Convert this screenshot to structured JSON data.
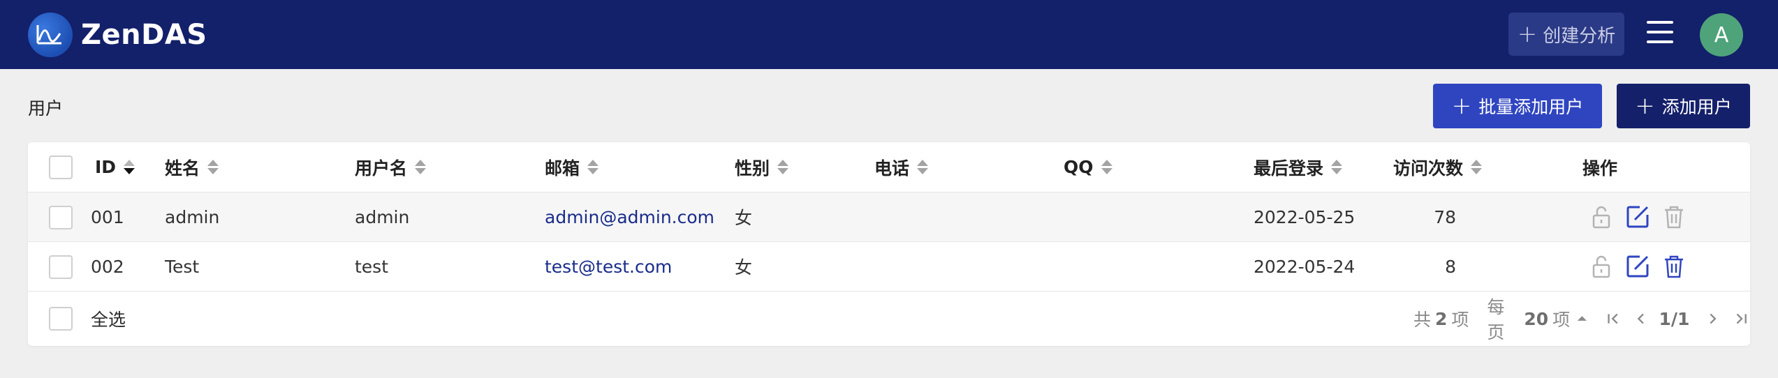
{
  "app": {
    "brand": "ZenDAS",
    "create_label": "创建分析",
    "avatar_letter": "A",
    "colors": {
      "header": "#13206a",
      "primary": "#2f45c0",
      "dark": "#14206a",
      "avatar": "#4fa37a",
      "link": "#1a2c8a"
    }
  },
  "page": {
    "title": "用户",
    "batch_add_label": "批量添加用户",
    "add_label": "添加用户"
  },
  "table": {
    "columns": [
      "ID",
      "姓名",
      "用户名",
      "邮箱",
      "性别",
      "电话",
      "QQ",
      "最后登录",
      "访问次数",
      "操作"
    ],
    "rows": [
      {
        "id": "001",
        "name": "admin",
        "username": "admin",
        "email": "admin@admin.com",
        "gender": "女",
        "phone": "",
        "qq": "",
        "last_login": "2022-05-25",
        "visits": "78"
      },
      {
        "id": "002",
        "name": "Test",
        "username": "test",
        "email": "test@test.com",
        "gender": "女",
        "phone": "",
        "qq": "",
        "last_login": "2022-05-24",
        "visits": "8"
      }
    ],
    "row_action_icons": [
      "unlock-icon",
      "edit-icon",
      "trash-icon"
    ]
  },
  "footer": {
    "select_all": "全选",
    "total_prefix": "共",
    "total_count": "2",
    "total_suffix": "项",
    "per_page_prefix": "每页",
    "per_page": "20",
    "per_page_suffix": "项",
    "page_indicator": "1/1"
  }
}
